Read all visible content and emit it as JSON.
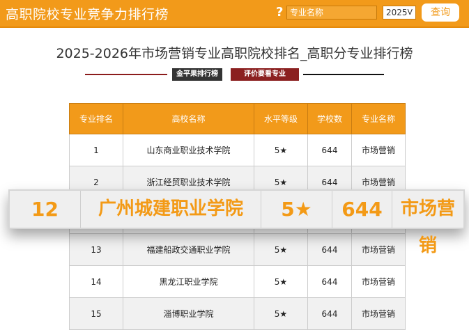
{
  "header": {
    "site_title": "高职院校专业竞争力排行榜",
    "help_icon": "?",
    "search_placeholder": "专业名称",
    "year": "2025",
    "query_button": "查询"
  },
  "page_title": "2025-2026年市场营销专业高职院校排名_高职分专业排行榜",
  "tags": [
    "金平果排行榜",
    "评价要看专业的！！！"
  ],
  "table": {
    "headers": [
      "专业排名",
      "高校名称",
      "水平等级",
      "学校数",
      "专业名称"
    ],
    "rows_top": [
      {
        "rank": "1",
        "school": "山东商业职业技术学院",
        "level": "5★",
        "count": "644",
        "major": "市场营销"
      },
      {
        "rank": "2",
        "school": "浙江经贸职业技术学院",
        "level": "5★",
        "count": "644",
        "major": "市场营销"
      }
    ],
    "rows_bottom": [
      {
        "rank": "13",
        "school": "福建船政交通职业学院",
        "level": "5★",
        "count": "644",
        "major": "市场营销"
      },
      {
        "rank": "14",
        "school": "黑龙江职业学院",
        "level": "5★",
        "count": "644",
        "major": "市场营销"
      },
      {
        "rank": "15",
        "school": "淄博职业学院",
        "level": "5★",
        "count": "644",
        "major": "市场营销"
      }
    ]
  },
  "highlight_row": {
    "rank": "12",
    "school": "广州城建职业学院",
    "level": "5★",
    "count": "644",
    "major": "市场营销"
  }
}
